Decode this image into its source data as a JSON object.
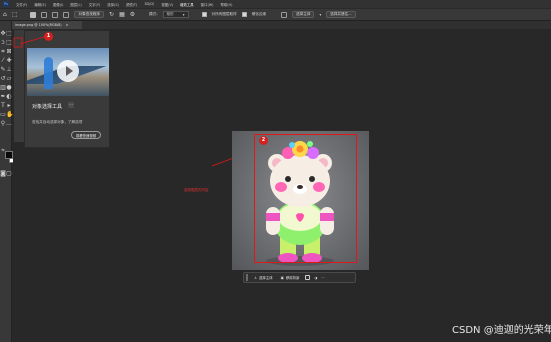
{
  "menubar": {
    "app_icon": "Ps",
    "items": [
      "文件(F)",
      "编辑(E)",
      "图像(I)",
      "图层(L)",
      "文字(Y)",
      "选择(S)",
      "滤镜(T)",
      "3D(D)",
      "视图(V)",
      "增效工具",
      "窗口(W)",
      "帮助(H)"
    ],
    "active_index": 9
  },
  "options_bar": {
    "mode_button": "对象查找程序",
    "mode_label": "模式:",
    "mode_value": "矩形",
    "sample_all_layers": "对所有图层取样",
    "enhance_edge": "硬化边缘",
    "select_subject": "选择主体",
    "select_and_mask": "选择并遮住..."
  },
  "document_tab": {
    "title": "image.png @ 100%(RGB/8)",
    "close": "×"
  },
  "tip_panel": {
    "title": "对象选择工具",
    "more": "···",
    "description": "查找并自动选择对象，了解选项",
    "learn_button": "观看快速视频"
  },
  "annotations": {
    "badge_1": "1",
    "badge_2": "2",
    "canvas_note": "选择图层的内容",
    "color": "#e01818"
  },
  "context_bar": {
    "select_subject": "选择主体",
    "remove_background": "移除背景",
    "more": "···"
  },
  "watermark": "CSDN @迪迦的光荣年华",
  "colors": {
    "app_bg": "#282828",
    "toolbar_bg": "#383838",
    "annotation_red": "#e01818"
  }
}
